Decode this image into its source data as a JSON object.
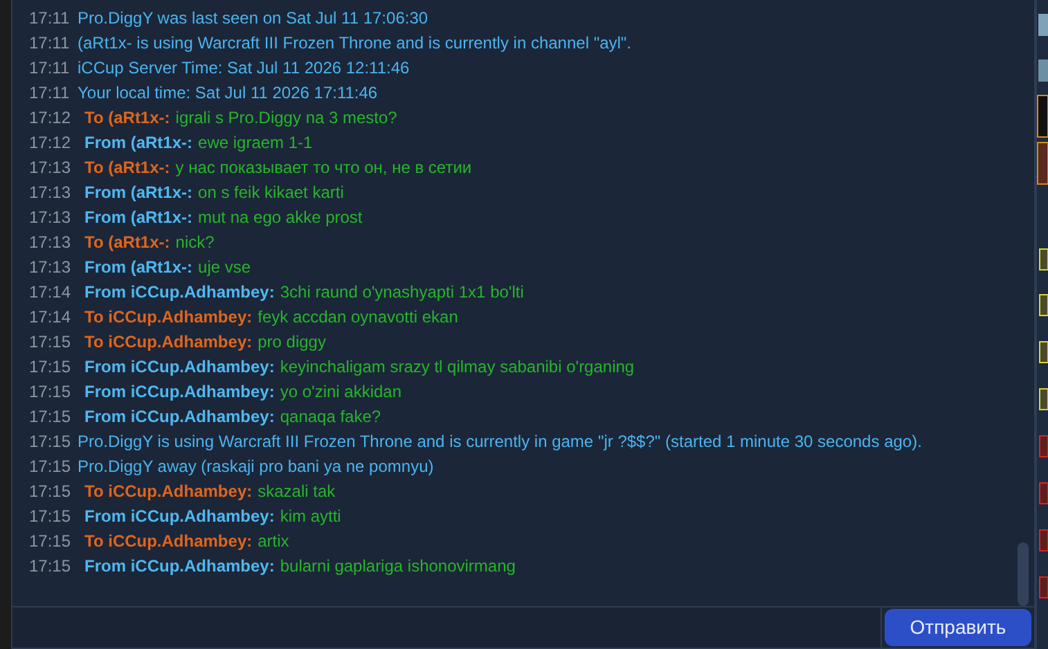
{
  "messages": [
    {
      "kind": "system",
      "time": "17:11",
      "text": "Pro.DiggY was last seen on Sat Jul 11 17:06:30"
    },
    {
      "kind": "system",
      "time": "17:11",
      "text": "(aRt1x- is using Warcraft III Frozen Throne and is currently in channel \"ayl\"."
    },
    {
      "kind": "system",
      "time": "17:11",
      "text": "iCCup Server Time: Sat Jul 11 2026 12:11:46"
    },
    {
      "kind": "system",
      "time": "17:11",
      "text": "Your local time: Sat Jul 11 2026 17:11:46"
    },
    {
      "kind": "to",
      "time": "17:12",
      "sender": "To (aRt1x-:",
      "text": "igrali s Pro.Diggy na 3 mesto?"
    },
    {
      "kind": "from",
      "time": "17:12",
      "sender": "From (aRt1x-:",
      "text": "ewe igraem 1-1"
    },
    {
      "kind": "to",
      "time": "17:13",
      "sender": "To (aRt1x-:",
      "text": "у нас показывает то что он, не в сетии"
    },
    {
      "kind": "from",
      "time": "17:13",
      "sender": "From (aRt1x-:",
      "text": "on s feik kikaet karti"
    },
    {
      "kind": "from",
      "time": "17:13",
      "sender": "From (aRt1x-:",
      "text": "mut na ego akke prost"
    },
    {
      "kind": "to",
      "time": "17:13",
      "sender": "To (aRt1x-:",
      "text": "nick?"
    },
    {
      "kind": "from",
      "time": "17:13",
      "sender": "From (aRt1x-:",
      "text": "uje vse"
    },
    {
      "kind": "from",
      "time": "17:14",
      "sender": "From iCCup.Adhambey:",
      "text": "3chi raund o'ynashyapti 1x1 bo'lti"
    },
    {
      "kind": "to",
      "time": "17:14",
      "sender": "To iCCup.Adhambey:",
      "text": "feyk accdan oynavotti ekan"
    },
    {
      "kind": "to",
      "time": "17:15",
      "sender": "To iCCup.Adhambey:",
      "text": "pro diggy"
    },
    {
      "kind": "from",
      "time": "17:15",
      "sender": "From iCCup.Adhambey:",
      "text": "keyinchaligam srazy tl qilmay sabanibi o'rganing"
    },
    {
      "kind": "from",
      "time": "17:15",
      "sender": "From iCCup.Adhambey:",
      "text": "yo o'zini akkidan"
    },
    {
      "kind": "from",
      "time": "17:15",
      "sender": "From iCCup.Adhambey:",
      "text": "qanaqa fake?"
    },
    {
      "kind": "system",
      "time": "17:15",
      "text": "Pro.DiggY is using Warcraft III Frozen Throne and is currently in  game \"jr ?$$?\" (started 1 minute 30 seconds ago)."
    },
    {
      "kind": "system",
      "time": "17:15",
      "text": "Pro.DiggY away (raskaji pro bani ya ne pomnyu)"
    },
    {
      "kind": "to",
      "time": "17:15",
      "sender": "To iCCup.Adhambey:",
      "text": "skazali tak"
    },
    {
      "kind": "from",
      "time": "17:15",
      "sender": "From iCCup.Adhambey:",
      "text": "kim aytti"
    },
    {
      "kind": "to",
      "time": "17:15",
      "sender": "To iCCup.Adhambey:",
      "text": "artix"
    },
    {
      "kind": "from",
      "time": "17:15",
      "sender": "From iCCup.Adhambey:",
      "text": "bularni gaplariga ishonovirmang"
    }
  ],
  "send_button": "Отправить"
}
